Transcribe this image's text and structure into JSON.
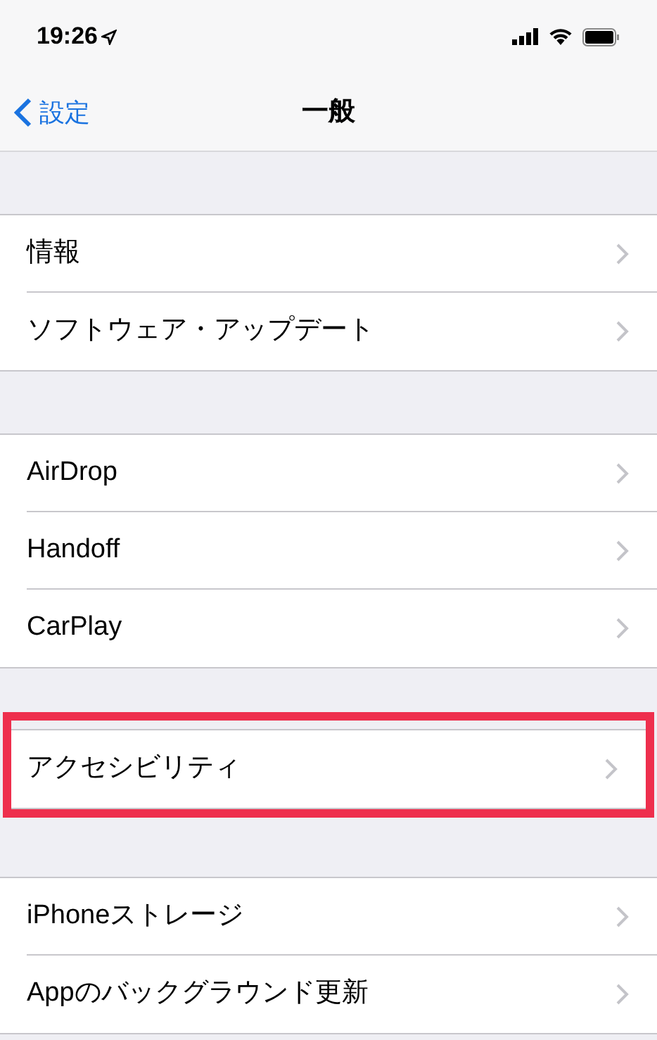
{
  "status_bar": {
    "time": "19:26"
  },
  "nav": {
    "back": "設定",
    "title": "一般"
  },
  "groups": [
    {
      "items": [
        {
          "label": "情報",
          "highlighted": false
        },
        {
          "label": "ソフトウェア・アップデート",
          "highlighted": false
        }
      ]
    },
    {
      "items": [
        {
          "label": "AirDrop",
          "highlighted": false
        },
        {
          "label": "Handoff",
          "highlighted": false
        },
        {
          "label": "CarPlay",
          "highlighted": false
        }
      ]
    },
    {
      "items": [
        {
          "label": "アクセシビリティ",
          "highlighted": true
        }
      ]
    },
    {
      "items": [
        {
          "label": "iPhoneストレージ",
          "highlighted": false
        },
        {
          "label": "Appのバックグラウンド更新",
          "highlighted": false
        }
      ]
    }
  ]
}
